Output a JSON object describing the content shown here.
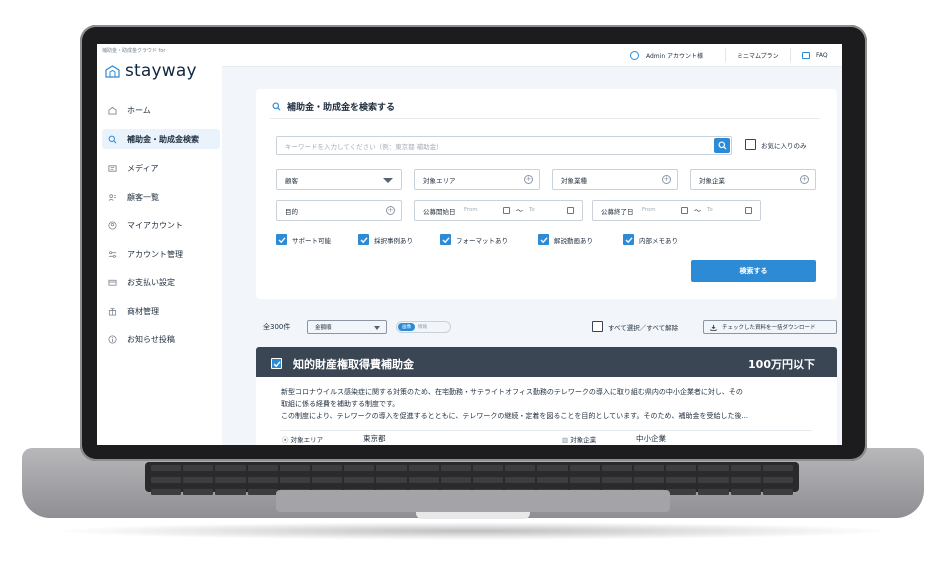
{
  "brand": {
    "subtitle": "補助金・助成金クラウド for",
    "name": "stayway"
  },
  "sidebar": {
    "items": [
      {
        "label": "ホーム",
        "icon": "home-icon",
        "active": false
      },
      {
        "label": "補助金・助成金検索",
        "icon": "search-icon",
        "active": true
      },
      {
        "label": "メディア",
        "icon": "media-icon",
        "active": false
      },
      {
        "label": "顧客一覧",
        "icon": "users-icon",
        "active": false
      },
      {
        "label": "マイアカウント",
        "icon": "account-icon",
        "active": false
      },
      {
        "label": "アカウント管理",
        "icon": "manage-icon",
        "active": false
      },
      {
        "label": "お支払い設定",
        "icon": "payment-icon",
        "active": false
      },
      {
        "label": "商材管理",
        "icon": "product-icon",
        "active": false
      },
      {
        "label": "お知らせ投稿",
        "icon": "info-icon",
        "active": false
      }
    ]
  },
  "topbar": {
    "account": "Admin アカウント様",
    "plan": "ミニマムプラン",
    "faq": "FAQ"
  },
  "search": {
    "title": "補助金・助成金を検索する",
    "keyword_placeholder": "キーワードを入力してください（例：東京都 補助金）",
    "favorites_only": "お気に入りのみ",
    "customer": "顧客",
    "area": "対象エリア",
    "industry": "対象業種",
    "company": "対象企業",
    "purpose": "目的",
    "start_label": "公募開始日",
    "end_label": "公募終了日",
    "from": "From",
    "to": "To",
    "tilde": "〜",
    "checkboxes": [
      "サポート可能",
      "採択事例あり",
      "フォーマットあり",
      "解説動画あり",
      "内部メモあり"
    ],
    "submit": "検索する"
  },
  "results": {
    "count": "全300件",
    "sort": "金額順",
    "view_on": "画像",
    "view_off": "情報",
    "select_all": "すべて選択／すべて解除",
    "download": "チェックした資料を一括ダウンロード"
  },
  "card": {
    "title": "知的財産権取得費補助金",
    "amount": "100万円以下",
    "desc1": "新型コロナウイルス感染症に関する対策のため、在宅勤務・サテライトオフィス勤務のテレワークの導入に取り組む県内の中小企業者に対し、その",
    "desc2": "取組に係る経費を補助する制度です。",
    "desc3": "この制度により、テレワークの導入を促進するとともに、テレワークの継続・定着を図ることを目的としています。そのため、補助金を受給した後...",
    "area_label": "対象エリア",
    "area_value": "東京都",
    "company_label": "対象企業",
    "company_value": "中小企業"
  },
  "colors": {
    "accent": "#2d8bd6",
    "card_header": "#3a4654",
    "bg": "#f2f5f9"
  }
}
